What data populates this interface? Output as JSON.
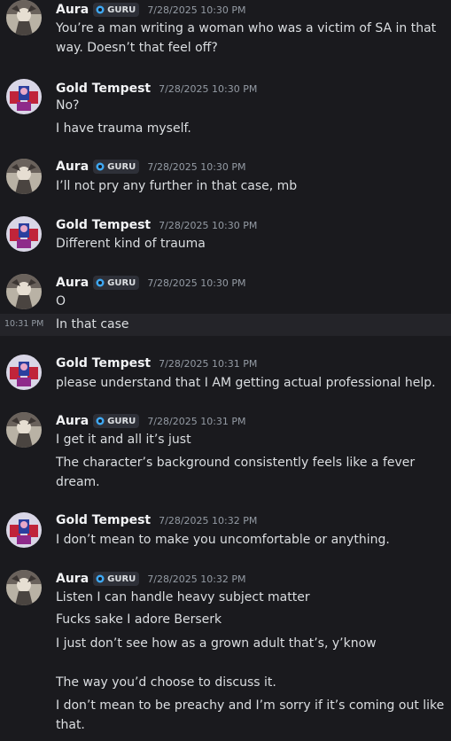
{
  "messages": [
    {
      "username": "Aura",
      "badge": "GURU",
      "timestamp": "7/28/2025 10:30 PM",
      "lines": [
        "You’re a man writing a woman who was a victim of SA in that way. Doesn’t that feel off?"
      ]
    },
    {
      "username": "Gold Tempest",
      "timestamp": "7/28/2025 10:30 PM",
      "lines": [
        "No?",
        "I have trauma myself."
      ]
    },
    {
      "username": "Aura",
      "badge": "GURU",
      "timestamp": "7/28/2025 10:30 PM",
      "lines": [
        "I’ll not pry any further in that case, mb"
      ]
    },
    {
      "username": "Gold Tempest",
      "timestamp": "7/28/2025 10:30 PM",
      "lines": [
        "Different kind of trauma"
      ]
    },
    {
      "username": "Aura",
      "badge": "GURU",
      "timestamp": "7/28/2025 10:30 PM",
      "lines": [
        "O",
        "In that case"
      ],
      "hover_time": "10:31 PM"
    },
    {
      "username": "Gold Tempest",
      "timestamp": "7/28/2025 10:31 PM",
      "lines": [
        "please understand that I AM getting actual professional help."
      ]
    },
    {
      "username": "Aura",
      "badge": "GURU",
      "timestamp": "7/28/2025 10:31 PM",
      "lines": [
        "I get it and all it’s just",
        "The character’s background consistently feels like a fever dream."
      ]
    },
    {
      "username": "Gold Tempest",
      "timestamp": "7/28/2025 10:32 PM",
      "lines": [
        "I don’t mean to make you uncomfortable or anything."
      ]
    },
    {
      "username": "Aura",
      "badge": "GURU",
      "timestamp": "7/28/2025 10:32 PM",
      "lines": [
        "Listen I can handle heavy subject matter",
        "Fucks sake I adore Berserk",
        "I just don’t see how as a grown adult that’s, y’know",
        "The way you’d choose to discuss it.",
        "I don’t mean to be preachy and I’m sorry if it’s coming out like that."
      ]
    }
  ]
}
